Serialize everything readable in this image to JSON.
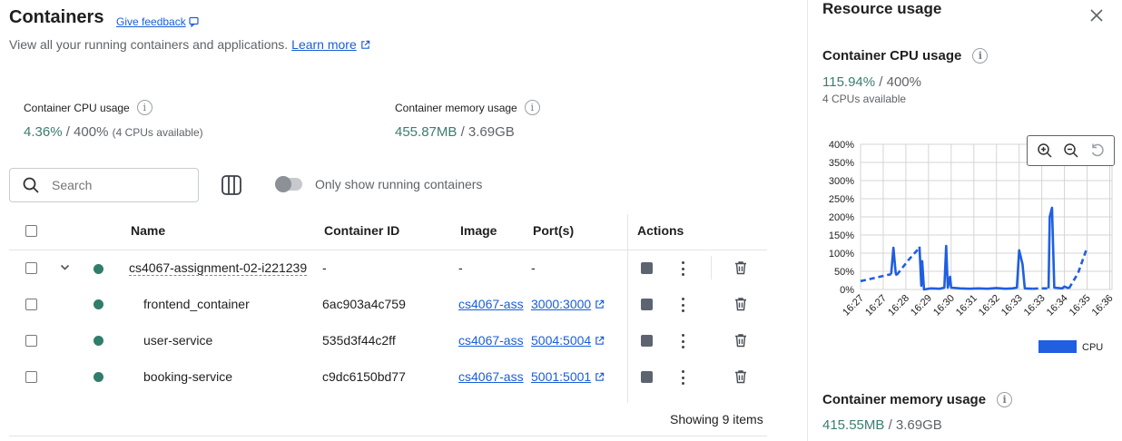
{
  "header": {
    "title": "Containers",
    "feedback": "Give feedback",
    "subtitle": "View all your running containers and applications.",
    "learn_more": "Learn more"
  },
  "stats": {
    "cpu_label": "Container CPU usage",
    "cpu_value": "4.36%",
    "cpu_total": "/ 400%",
    "cpu_note": "(4 CPUs available)",
    "mem_label": "Container memory usage",
    "mem_value": "455.87MB",
    "mem_total": "/ 3.69GB"
  },
  "toolbar": {
    "search_placeholder": "Search",
    "toggle_label": "Only show running containers",
    "toggle_on": false
  },
  "table": {
    "columns": [
      "Name",
      "Container ID",
      "Image",
      "Port(s)",
      "Actions"
    ],
    "rows": [
      {
        "name": "cs4067-assignment-02-i221239",
        "id": "-",
        "image": "-",
        "port": "-",
        "group": true
      },
      {
        "name": "frontend_container",
        "id": "6ac903a4c759",
        "image": "cs4067-ass",
        "port": "3000:3000",
        "group": false
      },
      {
        "name": "user-service",
        "id": "535d3f44c2ff",
        "image": "cs4067-ass",
        "port": "5004:5004",
        "group": false
      },
      {
        "name": "booking-service",
        "id": "c9dc6150bd77",
        "image": "cs4067-ass",
        "port": "5001:5001",
        "group": false
      }
    ],
    "footer": "Showing 9 items"
  },
  "panel": {
    "title": "Resource usage",
    "cpu_heading": "Container CPU usage",
    "cpu_value": "115.94%",
    "cpu_total": "/ 400%",
    "cpu_available": "4 CPUs available",
    "mem_heading": "Container memory usage",
    "mem_value": "415.55MB",
    "mem_total": "/ 3.69GB"
  },
  "chart_data": {
    "type": "line",
    "ylim": [
      0,
      400
    ],
    "yticks": [
      "400%",
      "350%",
      "300%",
      "250%",
      "200%",
      "150%",
      "100%",
      "50%",
      "0%"
    ],
    "xticks": [
      "16:27",
      "16:27",
      "16:28",
      "16:29",
      "16:30",
      "16:31",
      "16:32",
      "16:33",
      "16:33",
      "16:34",
      "16:35",
      "16:36"
    ],
    "legend": [
      "CPU"
    ],
    "series": [
      {
        "name": "CPU",
        "color": "#1f5fe0",
        "segments": [
          {
            "dashed": true,
            "points": [
              [
                0,
                23
              ],
              [
                0.5,
                30
              ],
              [
                1.2,
                40
              ],
              [
                1.35,
                42
              ]
            ]
          },
          {
            "dashed": false,
            "points": [
              [
                1.35,
                42
              ],
              [
                1.45,
                115
              ],
              [
                1.55,
                45
              ],
              [
                1.6,
                38
              ]
            ]
          },
          {
            "dashed": true,
            "points": [
              [
                1.6,
                40
              ],
              [
                2.1,
                80
              ],
              [
                2.6,
                115
              ]
            ]
          },
          {
            "dashed": false,
            "points": [
              [
                2.6,
                118
              ],
              [
                2.68,
                10
              ],
              [
                2.72,
                78
              ],
              [
                2.8,
                0
              ],
              [
                3.1,
                3
              ],
              [
                3.5,
                2
              ],
              [
                3.7,
                5
              ],
              [
                3.78,
                120
              ],
              [
                3.85,
                5
              ],
              [
                3.95,
                35
              ],
              [
                4.0,
                5
              ],
              [
                4.4,
                3
              ],
              [
                4.8,
                2
              ],
              [
                5.2,
                3
              ],
              [
                5.6,
                2
              ],
              [
                6.0,
                4
              ],
              [
                6.4,
                2
              ],
              [
                6.7,
                3
              ],
              [
                6.9,
                5
              ],
              [
                7.0,
                108
              ],
              [
                7.15,
                70
              ],
              [
                7.25,
                3
              ],
              [
                7.6,
                2
              ]
            ]
          },
          {
            "dashed": true,
            "points": [
              [
                7.6,
                2
              ],
              [
                7.9,
                3
              ],
              [
                8.3,
                3
              ]
            ]
          },
          {
            "dashed": false,
            "points": [
              [
                8.3,
                3
              ],
              [
                8.35,
                200
              ],
              [
                8.45,
                225
              ],
              [
                8.55,
                5
              ],
              [
                8.9,
                3
              ],
              [
                9.0,
                8
              ],
              [
                9.2,
                3
              ]
            ]
          },
          {
            "dashed": true,
            "points": [
              [
                9.2,
                3
              ],
              [
                9.6,
                45
              ],
              [
                10.0,
                115
              ]
            ]
          }
        ]
      }
    ]
  }
}
